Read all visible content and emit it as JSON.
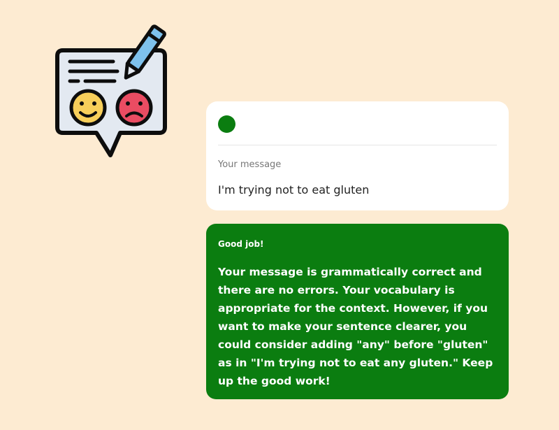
{
  "illustration": {
    "icon": "feedback-chat-icon",
    "colors": {
      "bubble": "#e3e9f1",
      "outline": "#0d0d0d",
      "happy_face": "#f8cf5a",
      "sad_face": "#ea4c62",
      "pencil": "#7ec1ec"
    }
  },
  "message": {
    "status_color": "#0b7d10",
    "label": "Your message",
    "text": "I'm trying not to eat gluten"
  },
  "feedback": {
    "title": "Good job!",
    "body": "Your message is grammatically correct and there are no errors. Your vocabulary is appropriate for the context. However, if you want to make your sentence clearer, you could consider adding \"any\" before \"gluten\" as in \"I'm trying not to eat any gluten.\" Keep up the good work!",
    "background": "#0b7d10"
  }
}
